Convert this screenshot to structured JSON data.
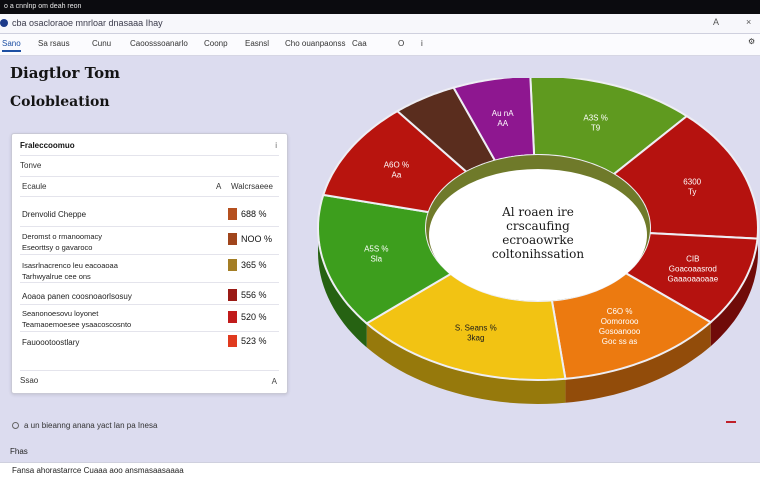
{
  "window": {
    "title": "o a cnnlnp om deah reon"
  },
  "tabbar": {
    "title": "cba osacloraoe mnrloar dnasaaa Ihay",
    "right_a": "A",
    "right_b": "×"
  },
  "toolbar": {
    "items": [
      "Sano",
      "Sa rsaus",
      "Cunu",
      "Caoosssoanarlo",
      "Coonp",
      "Easnsl",
      "Cho ouanpaonss",
      "Caa",
      "O",
      "i"
    ],
    "active_index": 0
  },
  "page": {
    "title": "Diagtlor Tom",
    "subtitle": "Colobleation"
  },
  "panel": {
    "header": "Fraleccoomuo",
    "header_icon": "i",
    "filter": "Tonve",
    "col_name": "Ecaule",
    "col_mid": "A",
    "col_val": "Walcrsaeee",
    "rows": [
      {
        "label": "Drenvolid Cheppe",
        "value": "688 %",
        "color": "#b5501f"
      },
      {
        "label": "Deromst o rmanoomacy\nEseorttsy o gavaroco",
        "value": "NOO %",
        "color": "#a0451c"
      },
      {
        "label": "Isasrlnacrenco leu eacoaoaa\nTarhwyalrue cee ons",
        "value": "365 %",
        "color": "#a47e25"
      },
      {
        "label": "Aoaoa panen coosnoaorlsosuy",
        "value": "556 %",
        "color": "#9a1a15"
      },
      {
        "label": "Seanonoesovu loyonet\nTeamaoemoesee ysaacoscosnto",
        "value": "520 %",
        "color": "#c11b1b"
      },
      {
        "label": "Fauoootoostlary",
        "value": "523 %",
        "color": "#e03a1f"
      }
    ],
    "footer": "Ssao",
    "footer_right": "A"
  },
  "hint": "a un bieanng anana yact lan pa Inesa",
  "foot_label": "Fhas",
  "status": "Fansa ahorastarrce Cuaaa aoo ansmasaasaaaa",
  "chart_data": {
    "type": "pie",
    "style": "3d-donut",
    "center_text": [
      "Al roaen ire",
      "crscaufing",
      "ecroaowrke",
      "coltonihssation"
    ],
    "segments": [
      {
        "label": "A3S %\nT9",
        "value": 13,
        "color": "#5f9a1f"
      },
      {
        "label": "6300\nTy",
        "value": 15,
        "color": "#b5120f"
      },
      {
        "label": "CIB\nGoacoaasrod\nGaaaoaaoaae",
        "value": 10,
        "color": "#b5120f"
      },
      {
        "label": "C6O %\nOomorooo\nGosoanooo\nGoc ss as",
        "value": 13,
        "color": "#ec7a10"
      },
      {
        "label": "S. Seans %\n3kag",
        "value": 17,
        "color": "#f2c313"
      },
      {
        "label": "A5S %\nSla",
        "value": 15,
        "color": "#3d9e1d"
      },
      {
        "label": "A6O %\nAa",
        "value": 11,
        "color": "#b8140e"
      },
      {
        "label": "",
        "value": 5,
        "color": "#5a2d1e"
      },
      {
        "label": "Au nA\nAA",
        "value": 6,
        "color": "#8e1790"
      }
    ]
  }
}
